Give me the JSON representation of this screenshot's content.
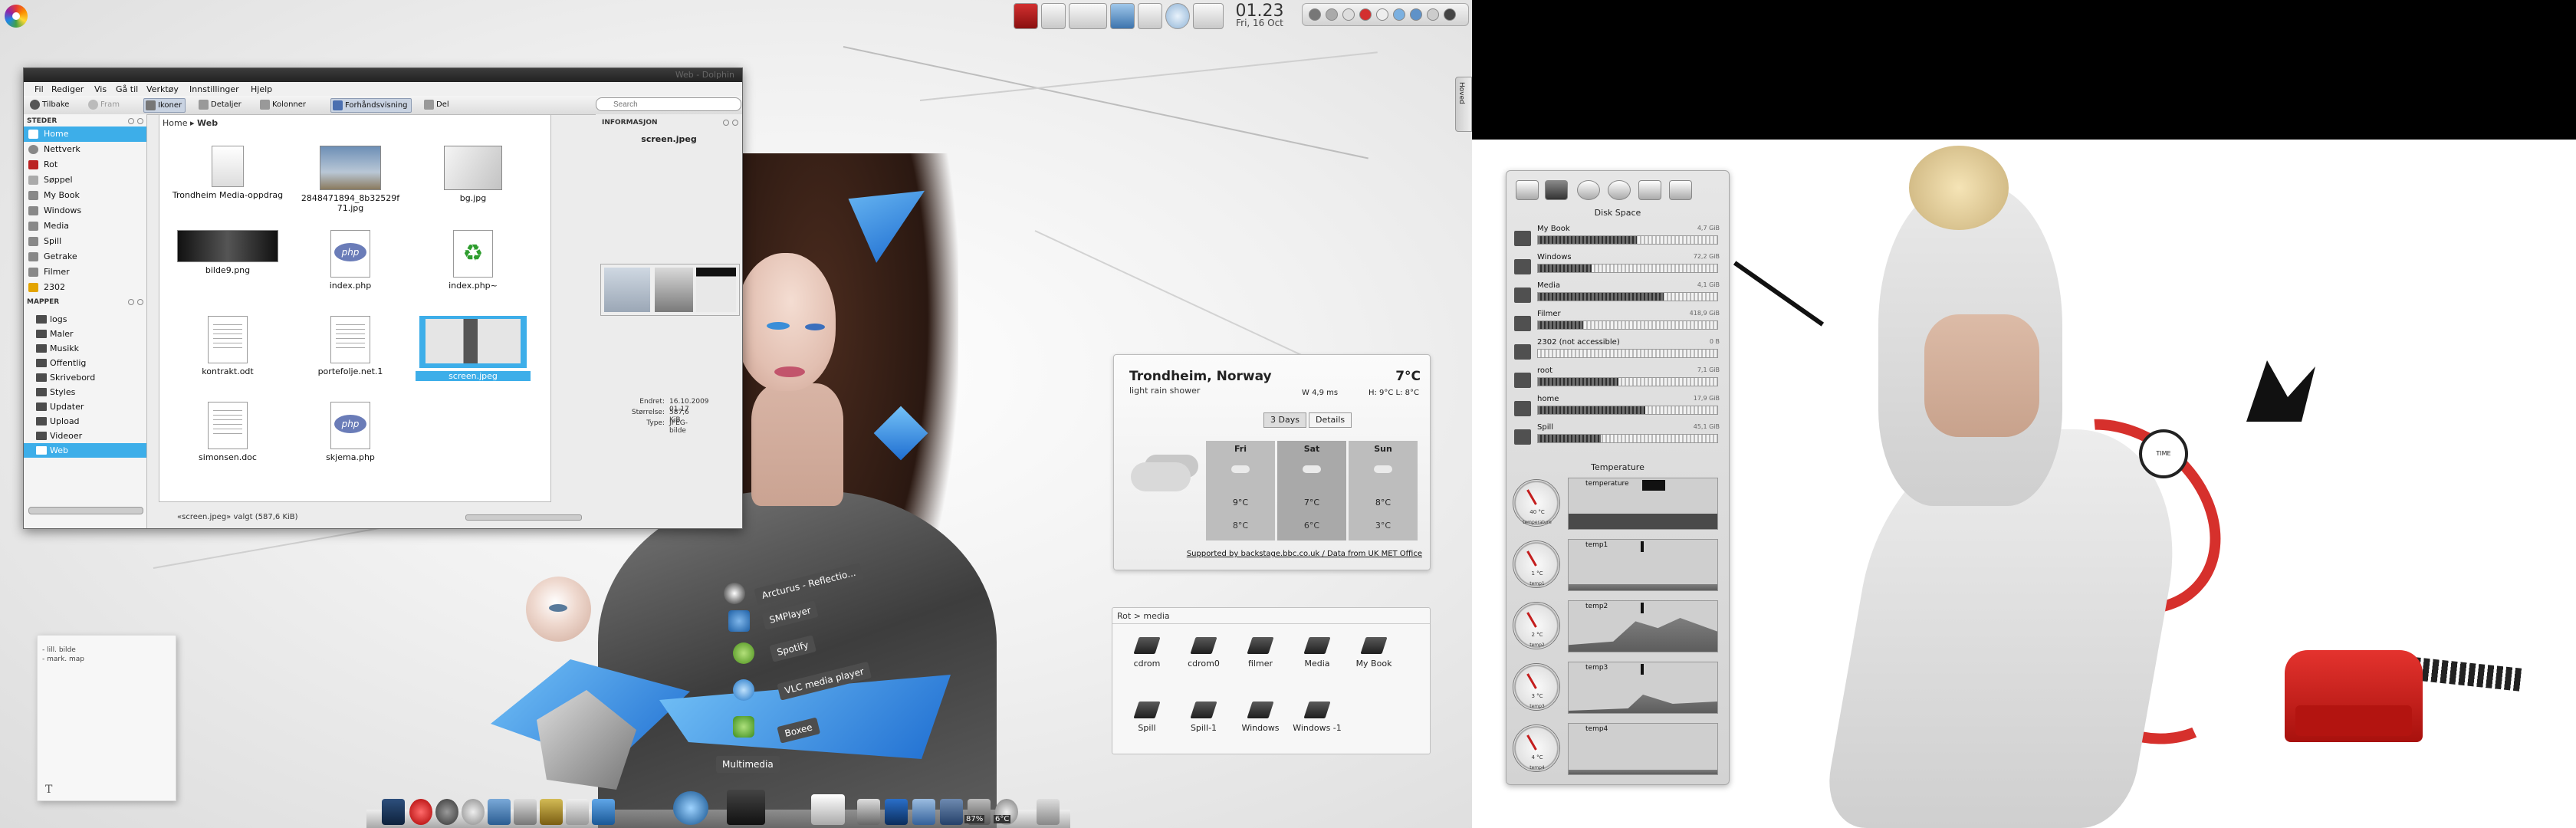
{
  "top_panel": {
    "clock_time": "01.23",
    "clock_date": "Fri, 16 Oct"
  },
  "dolphin": {
    "window_title": "Web - Dolphin",
    "menu": [
      "Fil",
      "Rediger",
      "Vis",
      "Gå til",
      "Verktøy",
      "Innstillinger",
      "Hjelp"
    ],
    "toolbar": {
      "back": "Tilbake",
      "forward": "Fram",
      "icons": "Ikoner",
      "details": "Detaljer",
      "columns": "Kolonner",
      "preview": "Forhåndsvisning",
      "split": "Del",
      "search_placeholder": "Search"
    },
    "places_header": "STEDER",
    "places": [
      "Home",
      "Nettverk",
      "Rot",
      "Søppel",
      "My Book",
      "Windows",
      "Media",
      "Spill",
      "Getrake",
      "Filmer",
      "2302"
    ],
    "folders_header": "MAPPER",
    "folders": [
      "logs",
      "Maler",
      "Musikk",
      "Offentlig",
      "Skrivebord",
      "Styles",
      "Updater",
      "Upload",
      "Videoer",
      "Web"
    ],
    "breadcrumb_home": "Home",
    "breadcrumb_current": "Web",
    "files": [
      {
        "name": "Trondheim Media-oppdrag"
      },
      {
        "name": "2848471894_8b32529f 71.jpg"
      },
      {
        "name": "bg.jpg"
      },
      {
        "name": "bilde9.png"
      },
      {
        "name": "index.php"
      },
      {
        "name": "index.php~"
      },
      {
        "name": "kontrakt.odt"
      },
      {
        "name": "portefolje.net.1"
      },
      {
        "name": "screen.jpeg"
      },
      {
        "name": "simonsen.doc"
      },
      {
        "name": "skjema.php"
      }
    ],
    "status": "«screen.jpeg» valgt (587,6 KiB)",
    "info": {
      "header": "INFORMASJON",
      "filename": "screen.jpeg",
      "rows": [
        {
          "k": "Endret:",
          "v": "16.10.2009 01.17"
        },
        {
          "k": "Størrelse:",
          "v": "587,6 KiB"
        },
        {
          "k": "Type:",
          "v": "JPEG-bilde"
        }
      ]
    }
  },
  "sticky_note": {
    "lines": [
      "- lill. bilde",
      "- mark. map"
    ],
    "tool_glyph": "T"
  },
  "launchers": [
    {
      "label": "Arcturus - Reflectio..."
    },
    {
      "label": "SMPlayer"
    },
    {
      "label": "Spotify"
    },
    {
      "label": "VLC media player"
    },
    {
      "label": "Boxee"
    },
    {
      "label": "Multimedia"
    }
  ],
  "weather": {
    "city": "Trondheim, Norway",
    "condition": "light rain shower",
    "temp": "7°C",
    "wind": "W 4,9 ms",
    "hilo": "H: 9°C L: 8°C",
    "tab_days": "3 Days",
    "tab_details": "Details",
    "days": [
      {
        "name": "Fri",
        "hi": "9°C",
        "lo": "8°C"
      },
      {
        "name": "Sat",
        "hi": "7°C",
        "lo": "6°C"
      },
      {
        "name": "Sun",
        "hi": "8°C",
        "lo": "3°C"
      }
    ],
    "credit": "Supported by backstage.bbc.co.uk / Data from UK MET Office"
  },
  "folder_view": {
    "title": "Rot > media",
    "items": [
      "cdrom",
      "cdrom0",
      "filmer",
      "Media",
      "My Book",
      "Spill",
      "Spill-1",
      "Windows",
      "Windows -1"
    ]
  },
  "dock": {
    "battery_label": "87%",
    "temp_label": "6°C"
  },
  "hoved_tab": "Hoved",
  "art_clock_text": "TIME",
  "sysmon": {
    "disk_title": "Disk Space",
    "disks": [
      {
        "name": "My Book",
        "size": "4,7 GiB",
        "used": 0.55
      },
      {
        "name": "Windows",
        "size": "72,2 GiB",
        "used": 0.3
      },
      {
        "name": "Media",
        "size": "4,1 GiB",
        "used": 0.7
      },
      {
        "name": "Filmer",
        "size": "418,9 GiB",
        "used": 0.25
      },
      {
        "name": "2302 (not accessible)",
        "size": "0 B",
        "used": 0.0
      },
      {
        "name": "root",
        "size": "7,1 GiB",
        "used": 0.45
      },
      {
        "name": "home",
        "size": "17,9 GiB",
        "used": 0.6
      },
      {
        "name": "Spill",
        "size": "45,1 GiB",
        "used": 0.35
      }
    ],
    "temp_title": "Temperature",
    "temps": [
      {
        "name": "temperature",
        "value": "40 °C"
      },
      {
        "name": "temp1",
        "value": "1 °C"
      },
      {
        "name": "temp2",
        "value": "2 °C"
      },
      {
        "name": "temp3",
        "value": "3 °C"
      },
      {
        "name": "temp4",
        "value": "4 °C"
      }
    ]
  }
}
